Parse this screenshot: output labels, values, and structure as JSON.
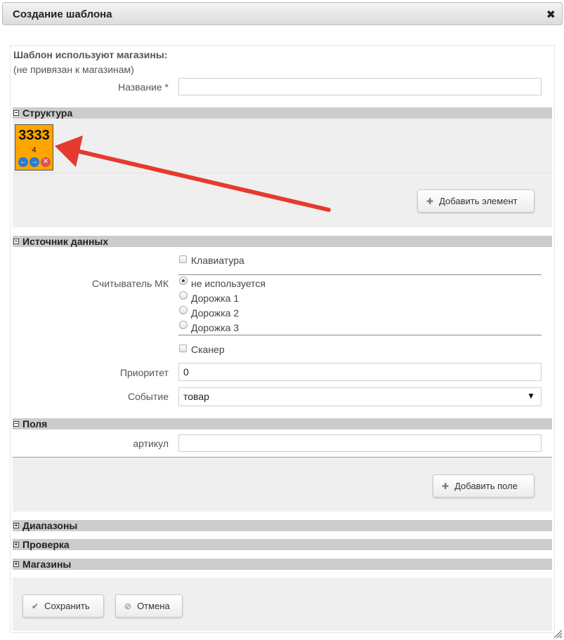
{
  "window": {
    "title": "Создание шаблона",
    "close_symbol": "✖"
  },
  "header": {
    "shops_label": "Шаблон используют магазины:",
    "shops_value": "(не привязан к магазинам)",
    "name_label": "Название *",
    "name_value": ""
  },
  "structure": {
    "title": "Структура",
    "toggle": "−",
    "tile": {
      "code": "3333",
      "number": "4",
      "color": "#ffa500"
    },
    "add_button": "Добавить элемент"
  },
  "datasource": {
    "title": "Источник данных",
    "toggle": "−",
    "keyboard_label": "Клавиатура",
    "reader_label": "Считыватель МК",
    "reader_options": [
      "не используется",
      "Дорожка 1",
      "Дорожка 2",
      "Дорожка 3"
    ],
    "reader_selected": "не используется",
    "scanner_label": "Сканер",
    "priority_label": "Приоритет",
    "priority_value": "0",
    "event_label": "Событие",
    "event_value": "товар"
  },
  "fields": {
    "title": "Поля",
    "toggle": "−",
    "article_label": "артикул",
    "article_value": "",
    "add_button": "Добавить поле"
  },
  "collapsed_sections": [
    {
      "title": "Диапазоны",
      "toggle": "+"
    },
    {
      "title": "Проверка",
      "toggle": "+"
    },
    {
      "title": "Магазины",
      "toggle": "+"
    }
  ],
  "footer": {
    "save_button": "Сохранить",
    "cancel_button": "Отмена"
  },
  "annotation": {
    "arrow_color": "#e53b2f"
  }
}
